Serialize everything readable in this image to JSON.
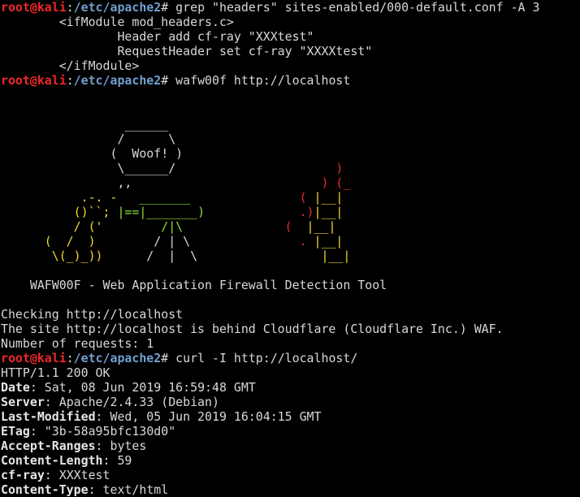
{
  "prompt": {
    "user": "root@kali",
    "colon": ":",
    "path": "/etc/apache2",
    "symbol": "#"
  },
  "cmd1": {
    "command": " grep \"headers\" sites-enabled/000-default.conf -A 3",
    "output": [
      "        <ifModule mod_headers.c>",
      "                Header add cf-ray \"XXXtest\"",
      "                RequestHeader set cf-ray \"XXXXtest\"",
      "        </ifModule>"
    ]
  },
  "cmd2": {
    "command": " wafw00f http://localhost"
  },
  "banner": {
    "rows": [
      [
        {
          "t": "                 ______",
          "c": "white"
        }
      ],
      [
        {
          "t": "                /      \\",
          "c": "white"
        }
      ],
      [
        {
          "t": "               (  Woof! )",
          "c": "white"
        }
      ],
      [
        {
          "t": "                \\______/",
          "c": "white"
        },
        {
          "t": "                      )",
          "c": "red"
        }
      ],
      [
        {
          "t": "                ,,",
          "c": "white"
        },
        {
          "t": "                          ) (_",
          "c": "red"
        }
      ],
      [
        {
          "t": "           .-. -",
          "c": "yellow"
        },
        {
          "t": "   _______",
          "c": "green"
        },
        {
          "t": "               ( ",
          "c": "red"
        },
        {
          "t": "|__|",
          "c": "yellow"
        }
      ],
      [
        {
          "t": "          ()``;",
          "c": "yellow"
        },
        {
          "t": " |==|_______)",
          "c": "green"
        },
        {
          "t": "             .)",
          "c": "red"
        },
        {
          "t": "|__|",
          "c": "yellow"
        }
      ],
      [
        {
          "t": "          / ('",
          "c": "yellow"
        },
        {
          "t": "        /|\\",
          "c": "green"
        },
        {
          "t": "              ( ",
          "c": "red"
        },
        {
          "t": " |__|",
          "c": "yellow"
        }
      ],
      [
        {
          "t": "      (  /  )",
          "c": "yellow"
        },
        {
          "t": "        / | \\",
          "c": "white"
        },
        {
          "t": "               . ",
          "c": "red"
        },
        {
          "t": "|__|",
          "c": "yellow"
        }
      ],
      [
        {
          "t": "       \\(_)_))",
          "c": "yellow"
        },
        {
          "t": "      /  |  \\",
          "c": "white"
        },
        {
          "t": "                 ",
          "c": "white"
        },
        {
          "t": "|__|",
          "c": "yellow"
        }
      ]
    ],
    "tool_line": "    WAFW00F - Web Application Firewall Detection Tool"
  },
  "cmd2_output": [
    "Checking http://localhost",
    "The site http://localhost is behind Cloudflare (Cloudflare Inc.) WAF.",
    "Number of requests: 1"
  ],
  "cmd3": {
    "command": " curl -I http://localhost/",
    "status_line": "HTTP/1.1 200 OK",
    "headers": [
      {
        "name": "Date",
        "value": ": Sat, 08 Jun 2019 16:59:48 GMT"
      },
      {
        "name": "Server",
        "value": ": Apache/2.4.33 (Debian)"
      },
      {
        "name": "Last-Modified",
        "value": ": Wed, 05 Jun 2019 16:04:15 GMT"
      },
      {
        "name": "ETag",
        "value": ": \"3b-58a95bfc130d0\""
      },
      {
        "name": "Accept-Ranges",
        "value": ": bytes"
      },
      {
        "name": "Content-Length",
        "value": ": 59"
      },
      {
        "name": "cf-ray",
        "value": ": XXXtest"
      },
      {
        "name": "Content-Type",
        "value": ": text/html"
      }
    ]
  },
  "colors": {
    "background": "#000000",
    "foreground": "#d8d8d8",
    "user": "#ef2929",
    "path": "#729fcf",
    "yellow": "#f5d72a",
    "green": "#8ae234",
    "red": "#ef2929"
  }
}
